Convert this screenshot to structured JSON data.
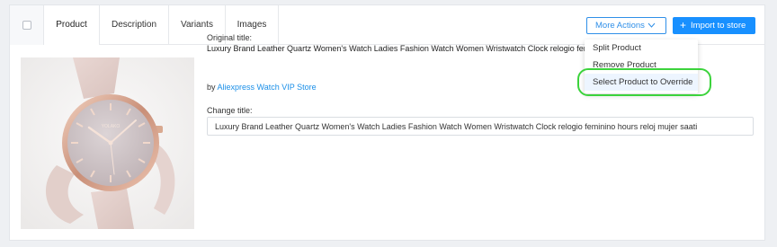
{
  "tabs": [
    {
      "label": "Product",
      "active": true
    },
    {
      "label": "Description"
    },
    {
      "label": "Variants"
    },
    {
      "label": "Images"
    }
  ],
  "actions": {
    "more_actions_label": "More Actions",
    "import_label": "Import to store"
  },
  "dropdown": {
    "items": [
      {
        "label": "Split Product"
      },
      {
        "label": "Remove Product"
      },
      {
        "label": "Select Product to Override",
        "highlighted": true
      }
    ]
  },
  "product": {
    "original_title_label": "Original title:",
    "original_title": "Luxury Brand Leather Quartz Women's Watch Ladies Fashion Watch Women Wristwatch Clock relogio feminino hours reloj mujer saati",
    "by_prefix": "by",
    "store_name": "Aliexpress Watch VIP Store",
    "change_title_label": "Change title:",
    "change_title_value": "Luxury Brand Leather Quartz Women's Watch Ladies Fashion Watch Women Wristwatch Clock relogio feminino hours reloj mujer saati",
    "image_brand_text": "YOLAKO"
  },
  "colors": {
    "accent": "#1890ff",
    "highlight_ring": "#3cd33c"
  }
}
